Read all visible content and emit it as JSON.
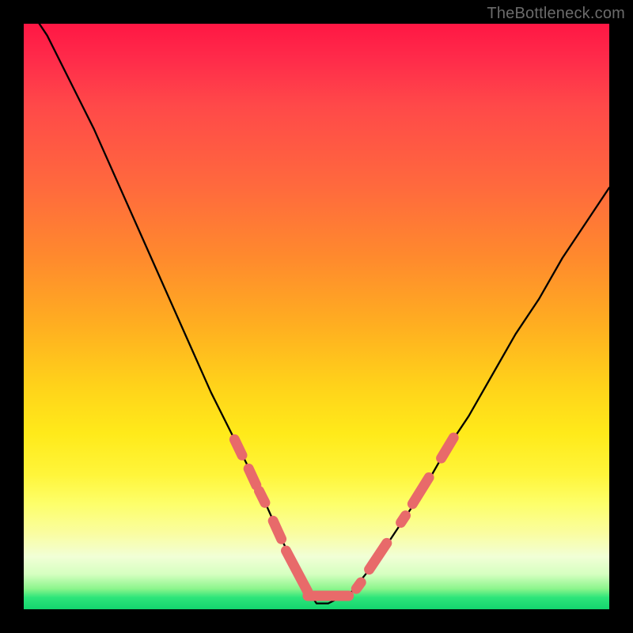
{
  "watermark": "TheBottleneck.com",
  "colors": {
    "frame": "#000000",
    "curve": "#000000",
    "marker": "#e86a6a",
    "gradient_stops": [
      "#ff1744",
      "#ff8a2d",
      "#ffd31a",
      "#fff53a",
      "#f1ffd6",
      "#14d56e"
    ]
  },
  "chart_data": {
    "type": "line",
    "title": "",
    "xlabel": "",
    "ylabel": "",
    "xlim": [
      0,
      100
    ],
    "ylim": [
      0,
      100
    ],
    "grid": false,
    "legend": false,
    "description": "V-shaped bottleneck curve on a vertical red-to-green gradient background. Y near 100 represents severe bottleneck (red), y near 0 represents balanced (green). The minimum of the curve is around x ≈ 50 with y ≈ 0.",
    "series": [
      {
        "name": "bottleneck-curve",
        "x": [
          0,
          4,
          8,
          12,
          16,
          20,
          24,
          28,
          32,
          36,
          40,
          44,
          48,
          50,
          52,
          56,
          60,
          64,
          68,
          72,
          76,
          80,
          84,
          88,
          92,
          96,
          100
        ],
        "y": [
          104,
          98,
          90,
          82,
          73,
          64,
          55,
          46,
          37,
          29,
          21,
          12,
          4,
          1,
          1,
          3,
          8,
          14,
          20,
          27,
          33,
          40,
          47,
          53,
          60,
          66,
          72
        ]
      }
    ],
    "markers": [
      {
        "name": "left-upper-dash",
        "x1": 36.0,
        "y1": 29.0,
        "x2": 37.3,
        "y2": 26.3
      },
      {
        "name": "left-mid-dash-a",
        "x1": 38.4,
        "y1": 24.0,
        "x2": 39.7,
        "y2": 21.2
      },
      {
        "name": "left-mid-dash-b",
        "x1": 40.2,
        "y1": 20.2,
        "x2": 41.2,
        "y2": 18.2
      },
      {
        "name": "left-low-dash",
        "x1": 42.6,
        "y1": 15.1,
        "x2": 44.0,
        "y2": 12.0
      },
      {
        "name": "bottom-long-1",
        "x1": 44.8,
        "y1": 10.0,
        "x2": 48.5,
        "y2": 3.0
      },
      {
        "name": "bottom-flat",
        "x1": 48.5,
        "y1": 2.3,
        "x2": 55.5,
        "y2": 2.3
      },
      {
        "name": "bottom-right-dot",
        "x1": 56.8,
        "y1": 3.5,
        "x2": 57.6,
        "y2": 4.6
      },
      {
        "name": "right-low-dash",
        "x1": 59.0,
        "y1": 6.8,
        "x2": 62.0,
        "y2": 11.3
      },
      {
        "name": "right-mid-dot",
        "x1": 64.4,
        "y1": 14.8,
        "x2": 65.2,
        "y2": 16.0
      },
      {
        "name": "right-upper-dash",
        "x1": 66.4,
        "y1": 18.0,
        "x2": 69.2,
        "y2": 22.5
      },
      {
        "name": "right-top-dash",
        "x1": 71.3,
        "y1": 25.8,
        "x2": 73.4,
        "y2": 29.3
      }
    ]
  }
}
